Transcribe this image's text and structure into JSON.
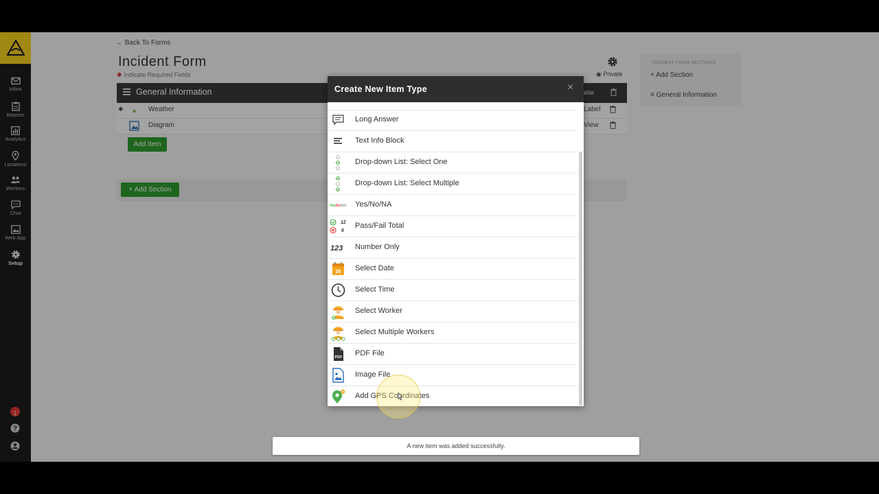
{
  "sidebar": {
    "items": [
      {
        "label": "Inbox",
        "icon": "envelope-icon"
      },
      {
        "label": "Reports",
        "icon": "clipboard-icon"
      },
      {
        "label": "Analytics",
        "icon": "bar-chart-icon"
      },
      {
        "label": "Locations",
        "icon": "map-pin-icon"
      },
      {
        "label": "Workers",
        "icon": "people-icon"
      },
      {
        "label": "Chat",
        "icon": "chat-bubble-icon"
      },
      {
        "label": "Web App",
        "icon": "image-frame-icon"
      },
      {
        "label": "Setup",
        "icon": "gear-icon"
      }
    ],
    "active": "Setup",
    "notification_count": "1"
  },
  "page": {
    "back_link": "Back To Forms",
    "title": "Incident Form",
    "required_note": "Indicate Required Fields",
    "privacy": "Private"
  },
  "section": {
    "title": "General Information",
    "right_label": "able",
    "rows": [
      {
        "label": "Weather",
        "action": "Label",
        "required": true
      },
      {
        "label": "Diagram",
        "action": "View",
        "required": false
      }
    ],
    "add_item": "Add Item",
    "add_section": "+ Add Section"
  },
  "right_panel": {
    "header": "INCIDENT FORM SECTIONS",
    "add_section": "Add Section",
    "section_item": "General Information"
  },
  "modal": {
    "title": "Create New Item Type",
    "close": "×",
    "items": [
      {
        "label": "Long Answer",
        "icon": "speech-bubble-icon"
      },
      {
        "label": "Text Info Block",
        "icon": "text-lines-icon"
      },
      {
        "label": "Drop-down List: Select One",
        "icon": "radio-list-icon"
      },
      {
        "label": "Drop-down List: Select Multiple",
        "icon": "checkbox-list-icon"
      },
      {
        "label": "Yes/No/NA",
        "icon": "yes-no-na-icon",
        "icon_text": "Yes No N/A"
      },
      {
        "label": "Pass/Fail Total",
        "icon": "pass-fail-icon",
        "icon_text": [
          "12",
          "6"
        ]
      },
      {
        "label": "Number Only",
        "icon": "number-icon",
        "icon_text": "123"
      },
      {
        "label": "Select Date",
        "icon": "calendar-icon",
        "icon_text": "26"
      },
      {
        "label": "Select Time",
        "icon": "clock-icon"
      },
      {
        "label": "Select Worker",
        "icon": "worker-icon"
      },
      {
        "label": "Select Multiple Workers",
        "icon": "workers-multiple-icon"
      },
      {
        "label": "PDF File",
        "icon": "pdf-file-icon",
        "icon_text": "PDF"
      },
      {
        "label": "Image File",
        "icon": "image-file-icon"
      },
      {
        "label": "Add GPS Coordinates",
        "icon": "gps-pin-icon"
      }
    ]
  },
  "toast": "A new item was added successfully.",
  "colors": {
    "brand": "#f7d21f",
    "sidebar": "#1c1c1c",
    "primary_button": "#2e9d2e",
    "header_dark": "#2e2e2e"
  }
}
